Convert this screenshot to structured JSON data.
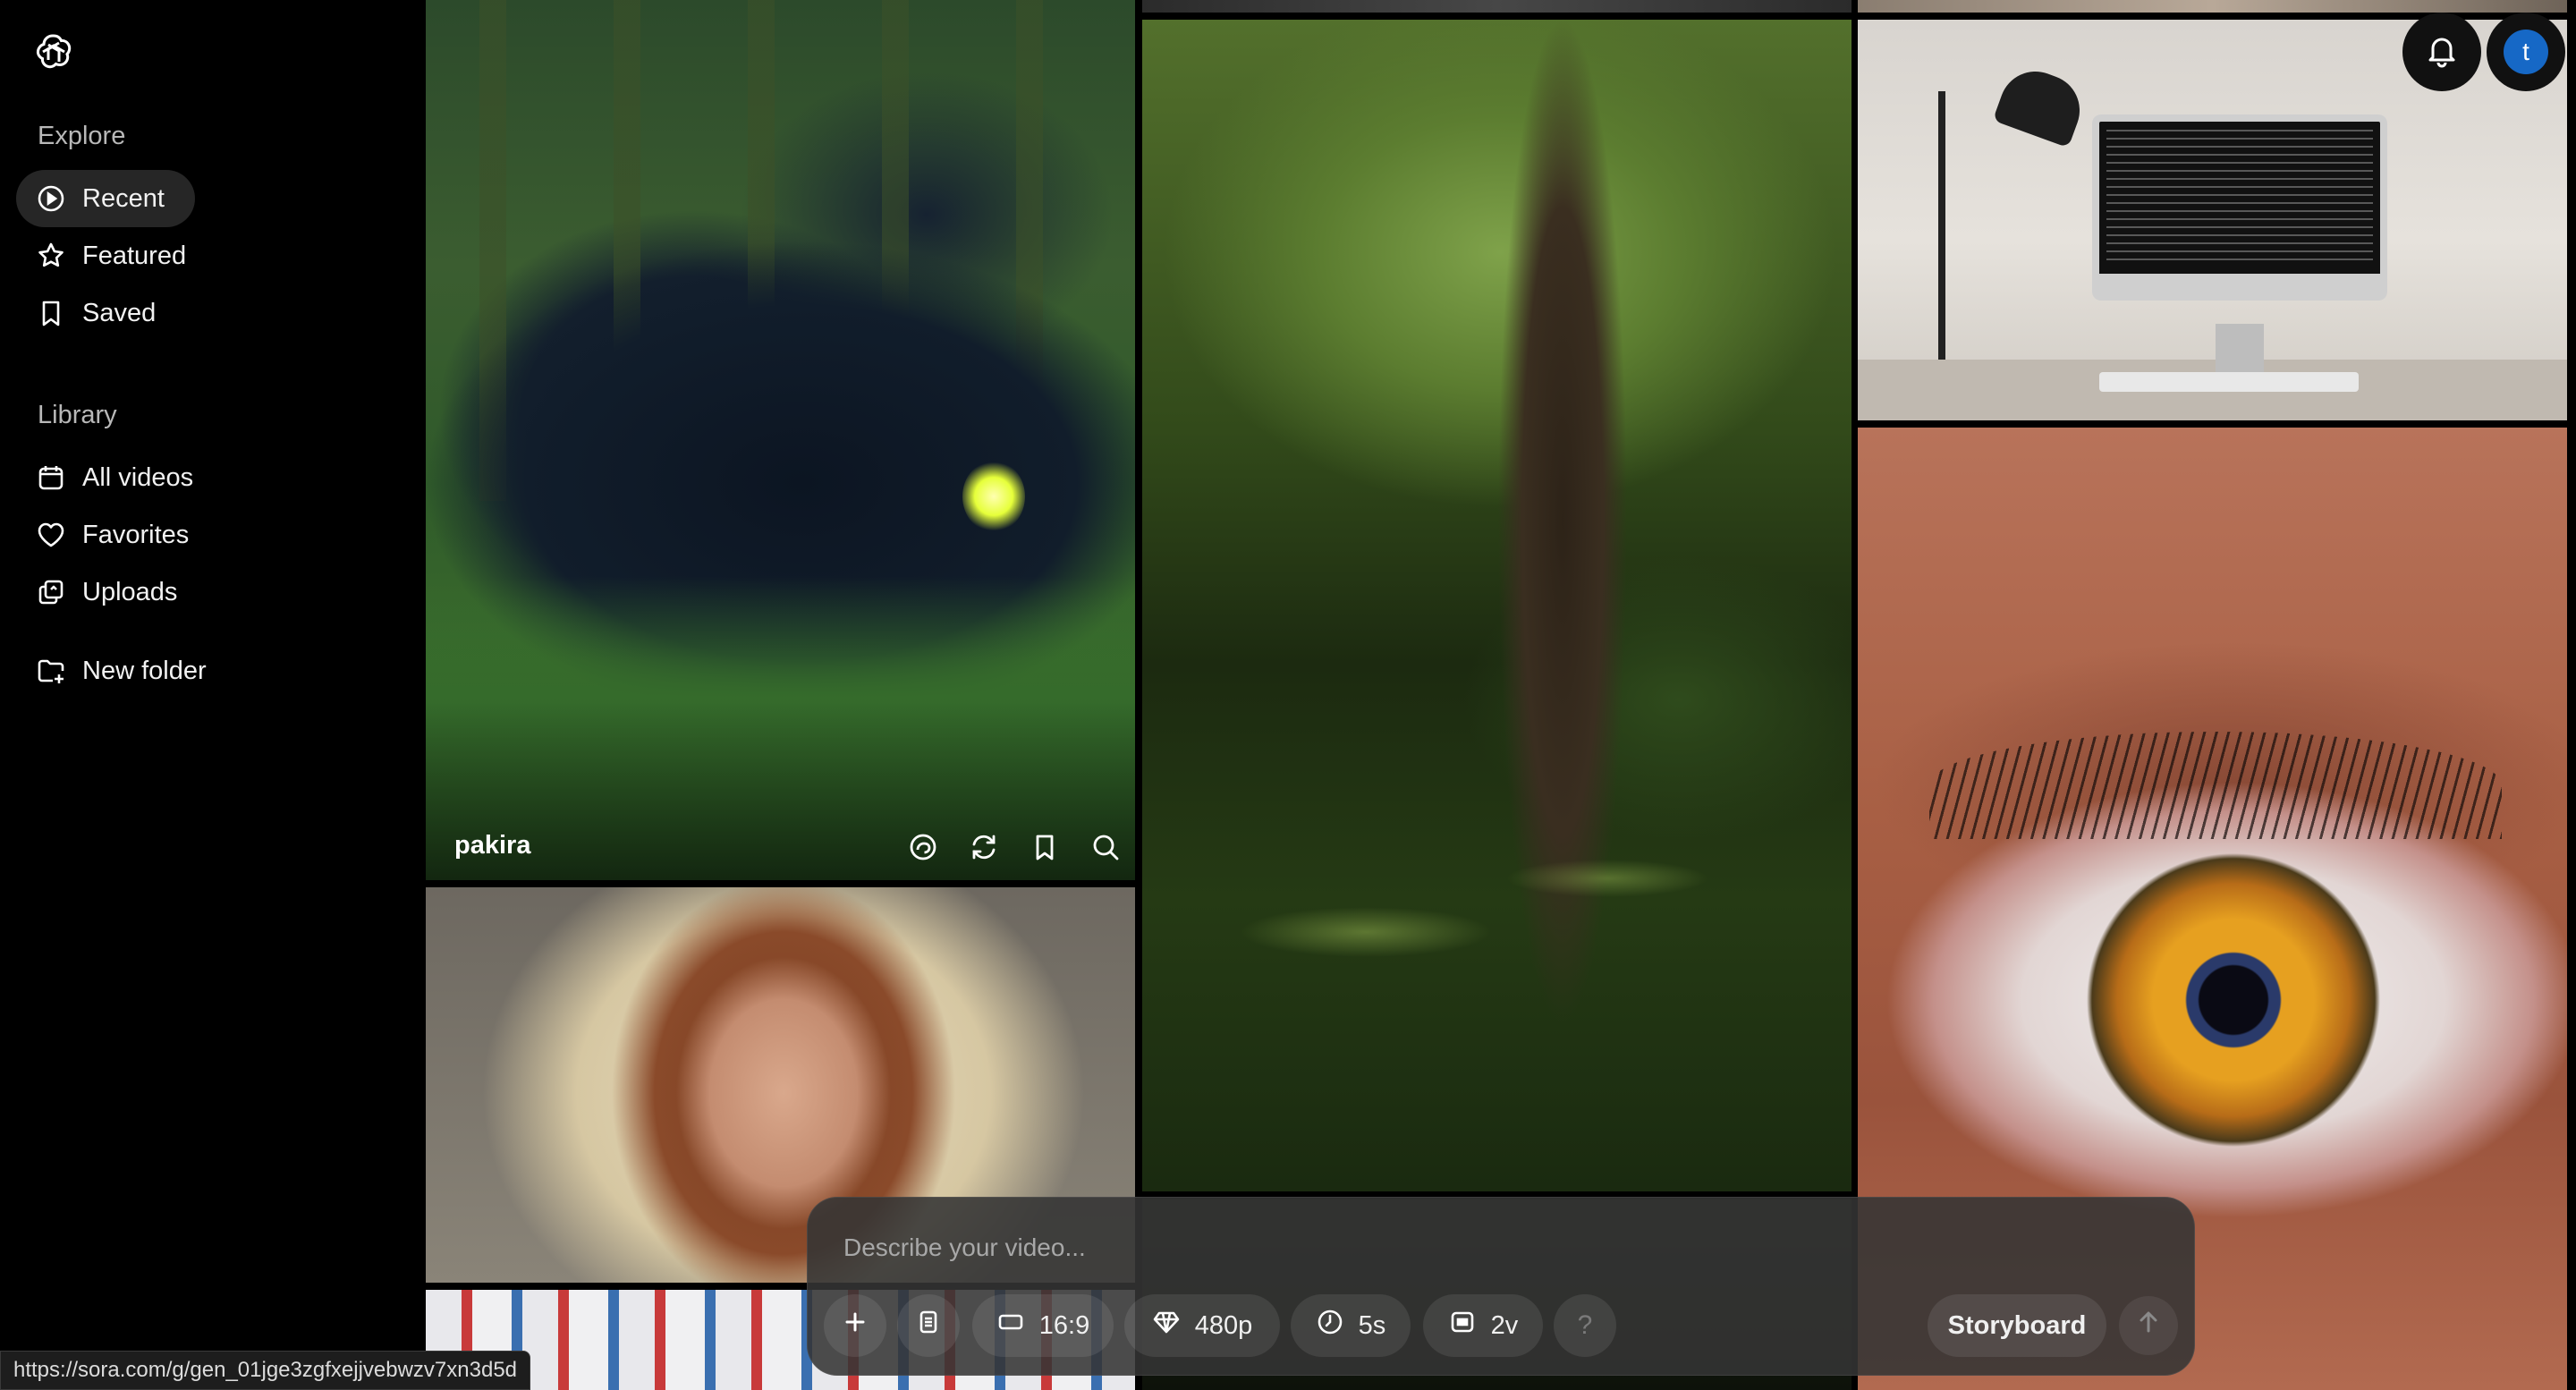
{
  "sidebar": {
    "logo_icon": "openai-logo-icon",
    "explore_label": "Explore",
    "explore_items": [
      {
        "label": "Recent",
        "icon": "play-circle-icon",
        "active": true
      },
      {
        "label": "Featured",
        "icon": "star-icon",
        "active": false
      },
      {
        "label": "Saved",
        "icon": "bookmark-icon",
        "active": false
      }
    ],
    "library_label": "Library",
    "library_items": [
      {
        "label": "All videos",
        "icon": "calendar-icon"
      },
      {
        "label": "Favorites",
        "icon": "heart-icon"
      },
      {
        "label": "Uploads",
        "icon": "upload-icon"
      }
    ],
    "new_folder_label": "New folder"
  },
  "grid": {
    "hovered_tile": {
      "caption": "pakira",
      "actions": [
        "loop-icon",
        "remix-icon",
        "bookmark-icon",
        "search-icon"
      ]
    }
  },
  "header": {
    "notifications_icon": "bell-icon",
    "avatar_initial": "t",
    "avatar_color": "#1668c6"
  },
  "composer": {
    "placeholder": "Describe your video...",
    "aspect_ratio": "16:9",
    "resolution": "480p",
    "duration": "5s",
    "variations": "2v",
    "help_label": "?",
    "storyboard_label": "Storyboard"
  },
  "status_bar": {
    "url": "https://sora.com/g/gen_01jge3zgfxejjvebwzv7xn3d5d"
  }
}
